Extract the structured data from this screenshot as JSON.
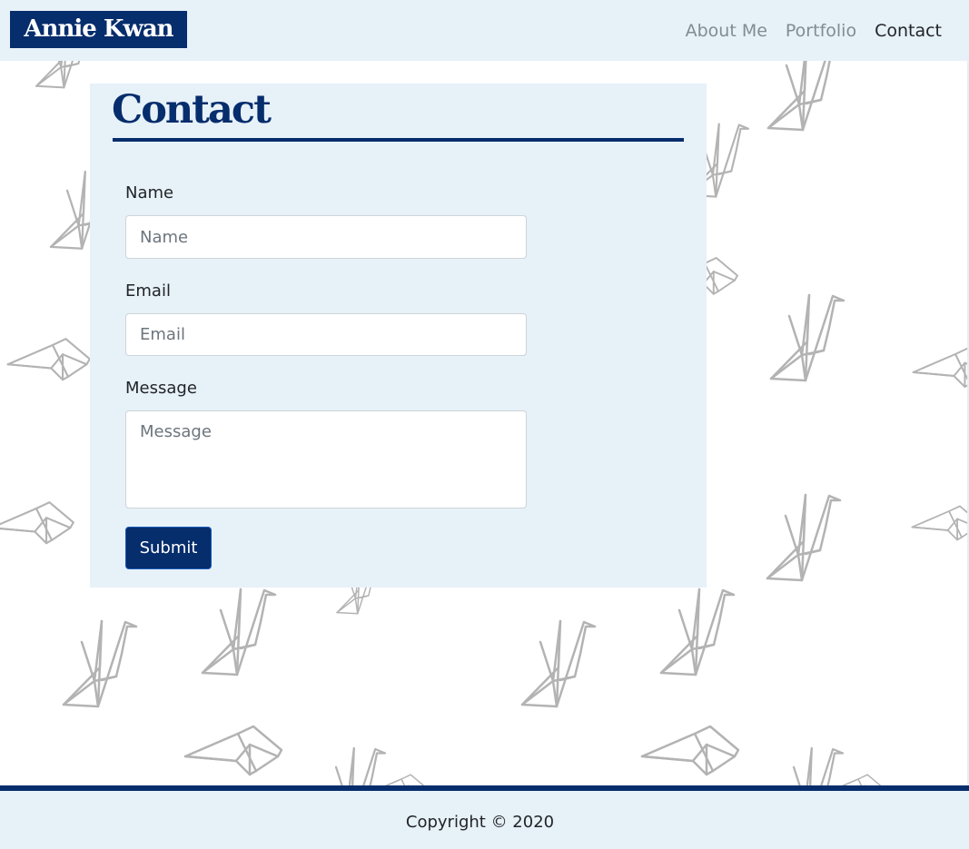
{
  "brand": {
    "name": "Annie Kwan",
    "color": "#062d6c"
  },
  "nav": {
    "items": [
      {
        "label": "About Me",
        "active": false
      },
      {
        "label": "Portfolio",
        "active": false
      },
      {
        "label": "Contact",
        "active": true
      }
    ]
  },
  "contact": {
    "title": "Contact",
    "name_label": "Name",
    "name_placeholder": "Name",
    "name_value": "",
    "email_label": "Email",
    "email_placeholder": "Email",
    "email_value": "",
    "message_label": "Message",
    "message_placeholder": "Message",
    "message_value": "",
    "submit_label": "Submit"
  },
  "footer": {
    "copyright": "Copyright © 2020"
  },
  "background": {
    "pattern": "paper-crane-icon",
    "stroke_color": "#b3b3b3"
  },
  "theme": {
    "panel_bg": "#e7f1f8",
    "accent": "#062d6c"
  }
}
